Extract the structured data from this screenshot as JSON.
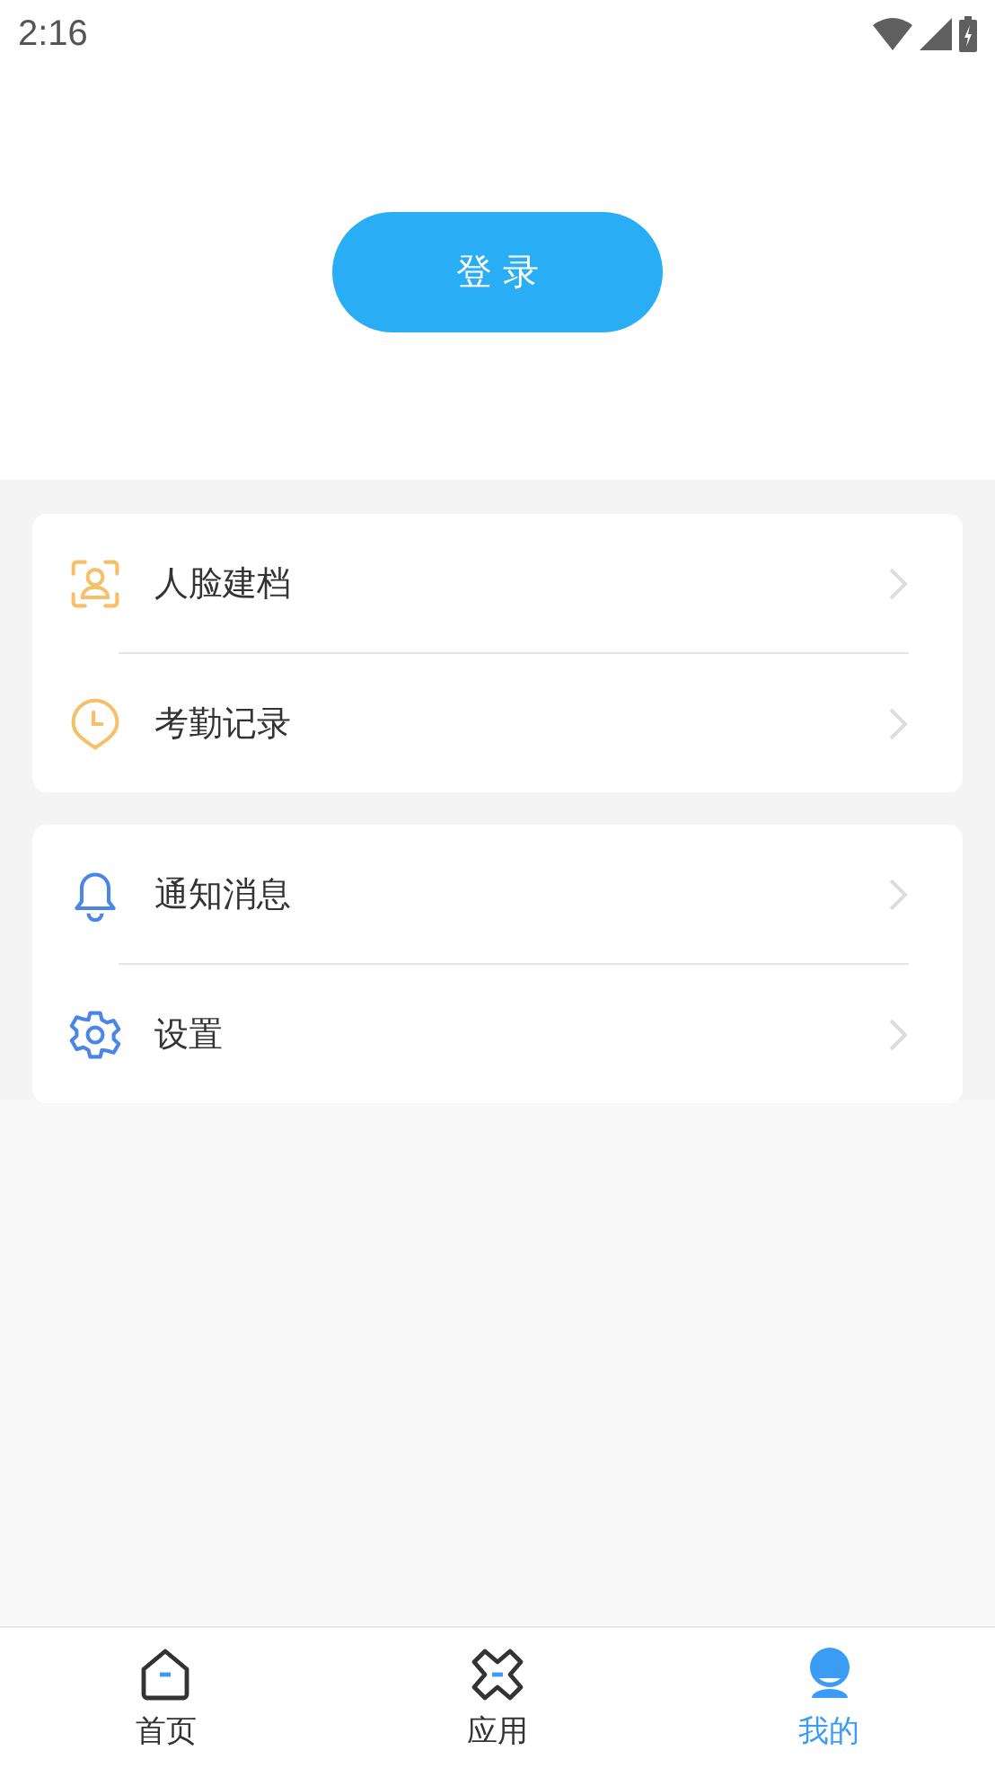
{
  "status_bar": {
    "time": "2:16"
  },
  "login_button": {
    "label": "登 录"
  },
  "menu_groups": [
    {
      "items": [
        {
          "label": "人脸建档",
          "kind": "face"
        },
        {
          "label": "考勤记录",
          "kind": "clock"
        }
      ]
    },
    {
      "items": [
        {
          "label": "通知消息",
          "kind": "bell"
        },
        {
          "label": "设置",
          "kind": "gear"
        }
      ]
    }
  ],
  "bottom_nav": [
    {
      "label": "首页",
      "kind": "home",
      "selected": false
    },
    {
      "label": "应用",
      "kind": "apps",
      "selected": false
    },
    {
      "label": "我的",
      "kind": "profile",
      "selected": true
    }
  ]
}
